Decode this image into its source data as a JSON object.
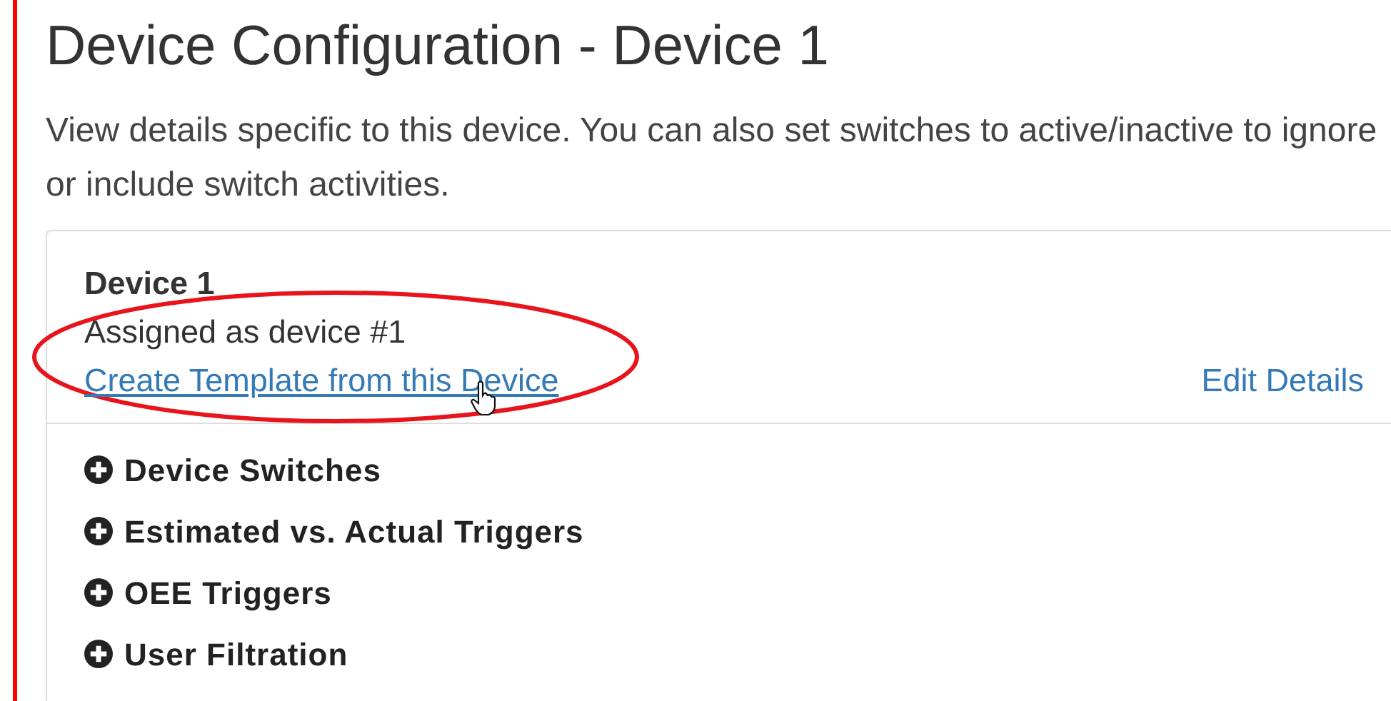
{
  "page": {
    "title": "Device Configuration - Device 1",
    "description": "View details specific to this device. You can also set switches to active/inactive to ignore or include switch activities."
  },
  "device_panel": {
    "name": "Device 1",
    "assignment": "Assigned as device #1",
    "template_link": "Create Template from this Device",
    "edit_link": "Edit Details"
  },
  "sections": [
    {
      "label": "Device Switches",
      "expanded": false
    },
    {
      "label": "Estimated vs. Actual Triggers",
      "expanded": false
    },
    {
      "label": "OEE Triggers",
      "expanded": false
    },
    {
      "label": "User Filtration",
      "expanded": false
    }
  ]
}
